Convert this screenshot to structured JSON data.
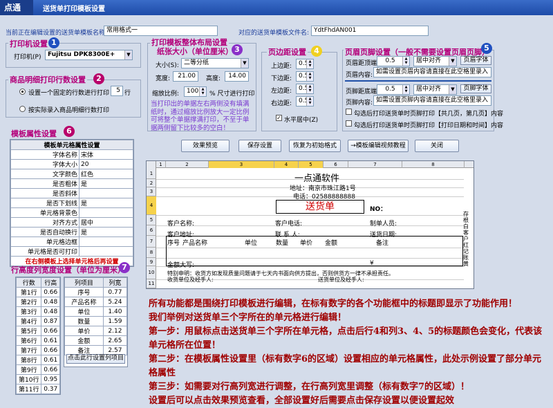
{
  "app": {
    "logo": "点通",
    "title": "送货单打印模板设置"
  },
  "header": {
    "cur_label": "当前正在编辑设置的送货单模板名称:",
    "cur_value": "常用格式一",
    "file_label": "对应的送货单模板文件名:",
    "file_value": "YdtFhdAN001"
  },
  "printer": {
    "title": "打印机设置",
    "badge": "1",
    "label": "打印机(P)",
    "value": "Fujitsu DPK8300E+"
  },
  "detail": {
    "title": "商品明细打印行数设置",
    "badge": "2",
    "opt1": "设置一个固定的行数进行打印",
    "rows": "5",
    "rows_unit": "行",
    "opt2": "按实际录入商品明细行数打印"
  },
  "layout": {
    "title": "打印模板整体布局设置",
    "paper_title": "纸张大小（单位厘米）",
    "badge": "3",
    "size_label": "大小(S):",
    "size_value": "二等分纸",
    "width_label": "宽度:",
    "width_value": "21.00",
    "height_label": "高度:",
    "height_value": "14.00",
    "zoom_label": "缩放比例:",
    "zoom_value": "100",
    "zoom_unit": "% 尺寸进行打印",
    "tip": "当打印出的单据左右两侧没有填满纸时，通过缩放比例放大一定比例可将整个单据撑满打印，不至于单据两侧留下比较多的空白！"
  },
  "margin": {
    "title": "页边距设置",
    "badge": "4",
    "top_label": "上边距:",
    "top": "0.5",
    "bottom_label": "下边距:",
    "bottom": "0.5",
    "left_label": "左边距:",
    "left": "0.5",
    "right_label": "右边距:",
    "right": "0.5",
    "center_label": "水平居中(Z)"
  },
  "headfoot": {
    "title": "页眉页脚设置（一般不需要设置页眉页脚）",
    "badge": "5",
    "hd_label": "页眉距顶端:",
    "hd_value": "0.5",
    "hd_align": "居中对齐",
    "hd_font": "页眉字体",
    "hc_label": "页眉内容:",
    "hc_value": "如需设置页眉内容请直接在此空格里录入",
    "fd_label": "页脚距底端:",
    "fd_value": "0.5",
    "fd_align": "居中对齐",
    "fd_font": "页脚字体",
    "fc_label": "页脚内容:",
    "fc_value": "如需设置页脚内容请直接在此空格里录入",
    "chk1": "勾选后打印送货单时页脚打印【共几页，第几页】内容",
    "chk2": "勾选后打印送货单时页脚打印【打印日期和时间】内容"
  },
  "buttons": {
    "preview": "效果预览",
    "save": "保存设置",
    "reset": "恢复为初始格式",
    "tutorial": "→模板编辑视频教程",
    "close": "关闭"
  },
  "props": {
    "title": "模板属性设置",
    "badge": "6",
    "header": "模板单元格属性设置",
    "rows": [
      [
        "字体名称",
        "宋体"
      ],
      [
        "字体大小",
        "20"
      ],
      [
        "文字颜色",
        "红色"
      ],
      [
        "是否粗体",
        "是"
      ],
      [
        "是否斜体",
        ""
      ],
      [
        "是否下划线",
        "是"
      ],
      [
        "单元格背景色",
        ""
      ],
      [
        "对齐方式",
        "居中"
      ],
      [
        "是否自动换行",
        "是"
      ],
      [
        "单元格边框",
        ""
      ],
      [
        "单元格是否可打印",
        ""
      ]
    ],
    "footer": "在右侧模板上选择单元格后再设置"
  },
  "rowcol": {
    "title": "行高度列宽度设置（单位为厘米）",
    "badge": "7",
    "rh_headers": [
      "行数",
      "行高"
    ],
    "rows": [
      [
        "第1行",
        "0.66"
      ],
      [
        "第2行",
        "0.48"
      ],
      [
        "第3行",
        "0.48"
      ],
      [
        "第4行",
        "0.87"
      ],
      [
        "第5行",
        "0.66"
      ],
      [
        "第6行",
        "0.61"
      ],
      [
        "第7行",
        "0.66"
      ],
      [
        "第8行",
        "0.61"
      ],
      [
        "第9行",
        "0.66"
      ],
      [
        "第10行",
        "0.95"
      ],
      [
        "第11行",
        "0.37"
      ]
    ],
    "cw_headers": [
      "列项目",
      "列宽"
    ],
    "cols": [
      [
        "序号",
        "0.77"
      ],
      [
        "产品名称",
        "5.24"
      ],
      [
        "单位",
        "1.40"
      ],
      [
        "数量",
        "1.59"
      ],
      [
        "单价",
        "2.12"
      ],
      [
        "金额",
        "2.65"
      ],
      [
        "备注",
        "2.57"
      ]
    ],
    "btn": "点击此行设置列项目"
  },
  "sheet": {
    "col_nums": [
      "1",
      "2",
      "3",
      "4",
      "5",
      "6",
      "7",
      "8"
    ],
    "row_nums": [
      "1",
      "2",
      "3",
      "4",
      "5",
      "6",
      "7",
      "8",
      "9",
      "10",
      "11"
    ],
    "company": "一点通软件",
    "address": "地址：南京市珠江路1号",
    "phone": "电话：02588888888",
    "doc_title": "送货单",
    "no": "NO：",
    "cust_name": "客户名称:",
    "cust_phone": "客户电话:",
    "maker": "制单人员:",
    "cust_addr": "客户地址:",
    "contact": "联 系 人:",
    "date": "送货日期:",
    "th": [
      "序号",
      "产品名称",
      "单位",
      "数量",
      "单价",
      "金额",
      "备注"
    ],
    "amount": "金额大写:",
    "yen": "¥",
    "clause": "特别申明：收货方如发现质量问题请于七天内书面向供方提出，否则供货方一律不承担责任。",
    "sign1": "收货单位及经手人:",
    "sign2": "送货单位及经手人:",
    "side": "存根 白客户 红记账 黄"
  },
  "notes": [
    "所有功能都是围绕打印模板进行编辑，在标有数字的各个功能框中的标题即显示了功能作用！",
    "我们举例对送货单三个字所在的单元格进行编辑！",
    "第一步：用鼠标点击送货单三个字所在单元格，点击后行4和列3、4、5的标题颜色会变化，代表该单元格所在位置！",
    "第二步：在模板属性设置里（标有数字6的区域）设置相应的单元格属性，此处示例设置了部分单元格属性",
    "第三步：如需要对行高列宽进行调整，在行高列宽里调整（标有数字7的区域）！",
    "设置后可以点击效果预览查看，全部设置好后需要点击保存设置以便设置起效"
  ]
}
